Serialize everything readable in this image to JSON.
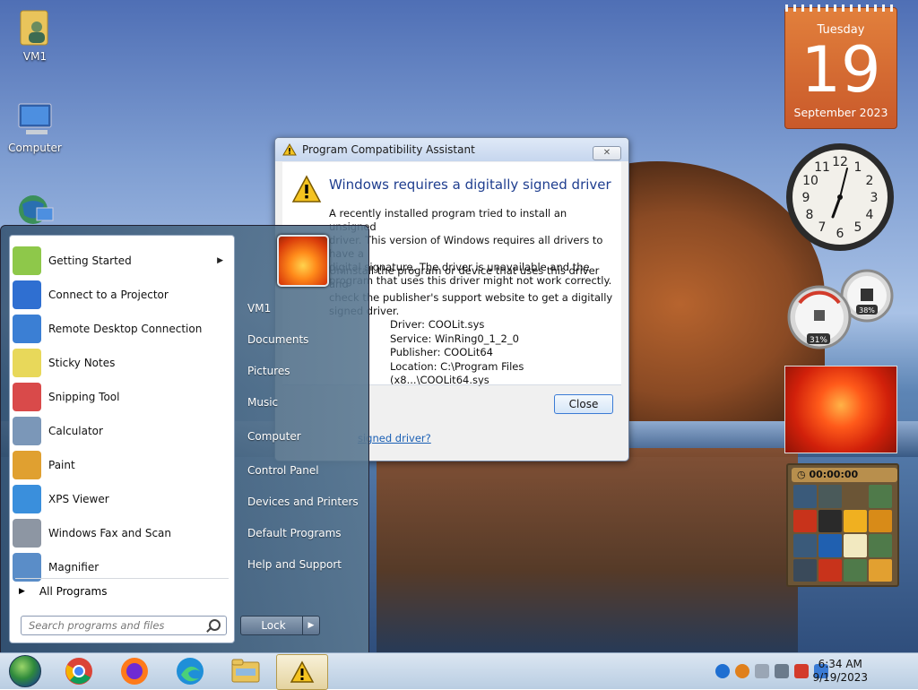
{
  "desktop": {
    "icons": [
      {
        "label": "VM1"
      },
      {
        "label": "Computer"
      }
    ]
  },
  "dialog": {
    "title": "Program Compatibility Assistant",
    "close_glyph": "✕",
    "heading": "Windows requires a digitally signed driver",
    "para1_lines": [
      "A recently installed program tried to install an unsigned",
      "driver. This version of Windows requires all drivers to have a",
      "digital signature. The driver is unavailable and the",
      "program that uses this driver might not work correctly."
    ],
    "para2_lines": [
      "Uninstall the program or device that uses this driver and",
      "check the publisher's support website to get a digitally",
      "signed driver."
    ],
    "details": {
      "driver": "Driver: COOLit.sys",
      "service": "Service: WinRing0_1_2_0",
      "publisher": "Publisher: COOLit64",
      "location": "Location: C:\\Program Files (x8...\\COOLit64.sys"
    },
    "close_button": "Close",
    "link": "signed driver?"
  },
  "start_menu": {
    "programs": [
      {
        "label": "Getting Started",
        "icon": "getting-started-icon",
        "color": "#8ec84a",
        "arrow": "▶"
      },
      {
        "label": "Connect to a Projector",
        "icon": "projector-icon",
        "color": "#2f6fd1"
      },
      {
        "label": "Remote Desktop Connection",
        "icon": "remote-desktop-icon",
        "color": "#3b7fd4"
      },
      {
        "label": "Sticky Notes",
        "icon": "sticky-notes-icon",
        "color": "#e8d85a"
      },
      {
        "label": "Snipping Tool",
        "icon": "snipping-tool-icon",
        "color": "#d94a4a"
      },
      {
        "label": "Calculator",
        "icon": "calculator-icon",
        "color": "#7b97b8"
      },
      {
        "label": "Paint",
        "icon": "paint-icon",
        "color": "#e0a030"
      },
      {
        "label": "XPS Viewer",
        "icon": "xps-viewer-icon",
        "color": "#3a8fdc"
      },
      {
        "label": "Windows Fax and Scan",
        "icon": "fax-scan-icon",
        "color": "#8d96a3"
      },
      {
        "label": "Magnifier",
        "icon": "magnifier-icon",
        "color": "#5a8dc8"
      }
    ],
    "all_programs": "All Programs",
    "all_programs_glyph": "▶",
    "search_placeholder": "Search programs and files",
    "right_items": [
      "VM1",
      "Documents",
      "Pictures",
      "Music",
      "Computer",
      "Control Panel",
      "Devices and Printers",
      "Default Programs",
      "Help and Support"
    ],
    "lock_label": "Lock",
    "lock_arrow": "▶"
  },
  "gadgets": {
    "calendar": {
      "day": "Tuesday",
      "date": "19",
      "month": "September 2023"
    },
    "clock_numbers": [
      "12",
      "1",
      "2",
      "3",
      "4",
      "5",
      "6",
      "7",
      "8",
      "9",
      "10",
      "11"
    ],
    "cpu_meter": {
      "cpu": "31%",
      "memory": "38%"
    },
    "puzzle": {
      "timer": "00:00:00"
    }
  },
  "taskbar": {
    "time": "6:34 AM",
    "date": "9/19/2023"
  }
}
